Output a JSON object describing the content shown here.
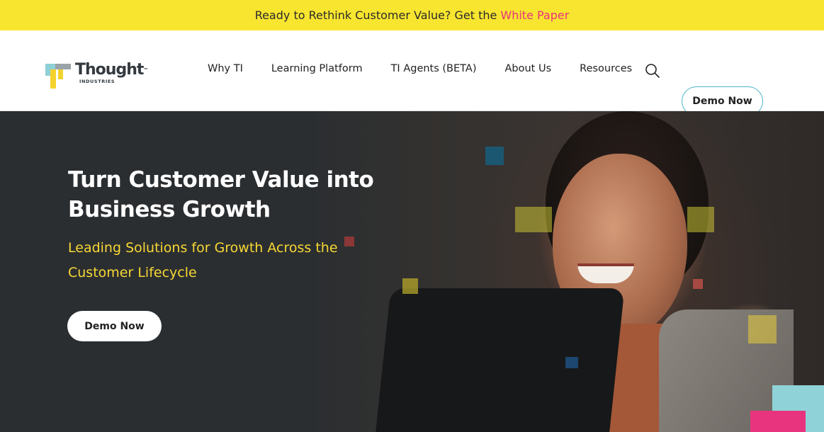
{
  "banner": {
    "text": "Ready to Rethink Customer Value? Get the",
    "link": "White Paper",
    "link_color": "#e8347e",
    "background": "#f8e52f"
  },
  "nav": {
    "logo": {
      "word": "Thought",
      "tm": "™",
      "sub": "INDUSTRIES"
    },
    "menu": [
      "Why TI",
      "Learning Platform",
      "TI Agents (BETA)",
      "About Us",
      "Resources"
    ],
    "search_icon": "search-icon",
    "demo_button": "Demo Now",
    "demo_border_color": "#4fb7c9"
  },
  "hero": {
    "title": "Turn Customer Value into Business Growth",
    "subtitle": "Leading Solutions for Growth Across the Customer Lifecycle",
    "subtitle_color": "#f7d834",
    "demo_button": "Demo Now",
    "background": "#2b2e31"
  }
}
